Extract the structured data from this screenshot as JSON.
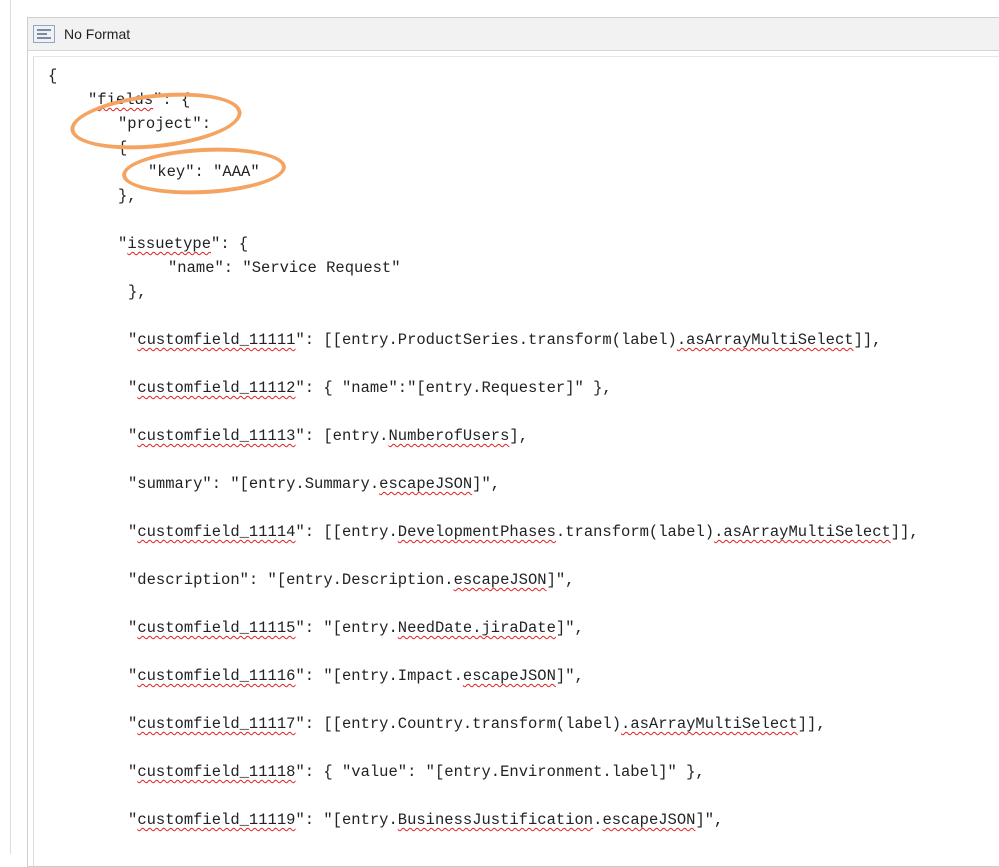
{
  "panel": {
    "title": "No Format",
    "icon": "format-code-icon"
  },
  "highlight_color": "#f4a460",
  "code": {
    "lines": [
      [
        "{"
      ],
      [
        "\"",
        "fields",
        "\": {"
      ],
      [
        "\"project\":"
      ],
      [
        "{"
      ],
      [
        "\"key\": \"AAA\""
      ],
      [
        "},"
      ],
      [
        "\"",
        "issuetype",
        "\": {"
      ],
      [
        "\"name\": \"Service Request\""
      ],
      [
        "},"
      ],
      [
        "\"",
        "customfield_11111",
        "\": [[entry.ProductSeries.transform(label)",
        ".asArrayMultiSelect",
        "]],"
      ],
      [
        "\"",
        "customfield_11112",
        "\": { \"name\":\"[entry.Requester]\" },"
      ],
      [
        "\"",
        "customfield_11113",
        "\": [entry.",
        "NumberofUsers",
        "],"
      ],
      [
        "\"summary\": \"[entry.Summary.",
        "escapeJSON",
        "]\","
      ],
      [
        "\"",
        "customfield_11114",
        "\": [[entry.",
        "DevelopmentPhases",
        ".transform(label)",
        ".asArrayMultiSelect",
        "]],"
      ],
      [
        "\"description\": \"[entry.Description.",
        "escapeJSON",
        "]\","
      ],
      [
        "\"",
        "customfield_11115",
        "\": \"[entry.",
        "NeedDate.jiraDate",
        "]\","
      ],
      [
        "\"",
        "customfield_11116",
        "\": \"[entry.Impact.",
        "escapeJSON",
        "]\","
      ],
      [
        "\"",
        "customfield_11117",
        "\": [[entry.Country.transform(label)",
        ".asArrayMultiSelect",
        "]],"
      ],
      [
        "\"",
        "customfield_11118",
        "\": { \"value\": \"[entry.Environment.label]\" },"
      ],
      [
        "\"",
        "customfield_11119",
        "\": \"[entry.",
        "BusinessJustification",
        ".",
        "escapeJSON",
        "]\","
      ]
    ]
  }
}
